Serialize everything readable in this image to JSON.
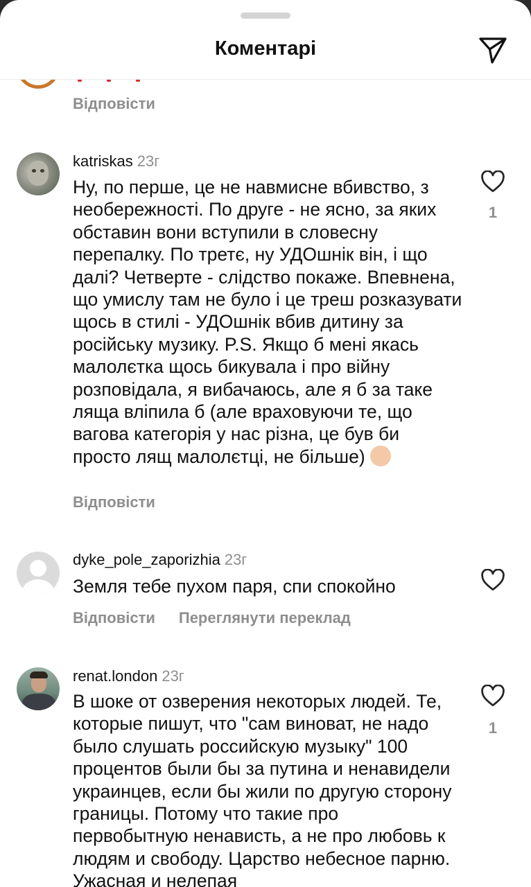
{
  "header": {
    "title": "Коментарі"
  },
  "comments": [
    {
      "reply_label": "Відповісти"
    },
    {
      "username": "katriskas",
      "time": "23г",
      "text": "Ну, по перше, це не навмисне вбивство, з необережності. По друге - не ясно, за яких обставин вони вступили в словесну перепалку. По третє, ну УДОшнік він, і що далі? Четверте - слідство покаже. Впевнена, що умислу там не було і це треш розказувати щось в стилі - УДОшнік вбив дитину за російську музику. P.S. Якщо б мені якась малолєтка щось бикувала і про війну розповідала, я вибачаюсь, але я б за таке ляща вліпила б (але враховуючи те, що вагова категорія у нас різна, це був би просто лящ малолєтці, не більше)",
      "emoji_icon": "person-shrugging-emoji",
      "likes": "1",
      "reply_label": "Відповісти"
    },
    {
      "username": "dyke_pole_zaporizhia",
      "time": "23г",
      "text": "Земля тебе пухом паря, спи спокойно",
      "reply_label": "Відповісти",
      "translate_label": "Переглянути переклад"
    },
    {
      "username": "renat.london",
      "time": "23г",
      "text": "В шоке от озверения некоторых людей. Те, которые пишут, что \"сам виноват, не надо было слушать российскую музыку\" 100 процентов были бы за путина и ненавидели украинцев, если бы жили по другую сторону границы. Потому что такие про первобытную ненависть, а не про любовь к людям и свободу. Царство небесное парню. Ужасная и нелепая",
      "likes": "1"
    }
  ],
  "icons": {
    "send": "paper-plane-icon",
    "like": "heart-outline-icon",
    "default_avatar": "default-avatar-icon"
  },
  "colors": {
    "primary_text": "#111111",
    "secondary_text": "#8e8e8e",
    "divider": "#ececec"
  }
}
